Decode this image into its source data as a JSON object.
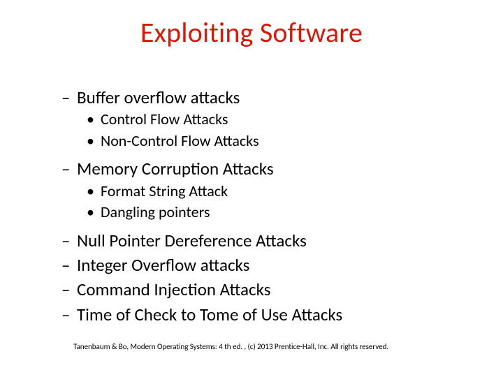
{
  "title": "Exploiting Software",
  "bullets": {
    "b1": "Buffer overflow attacks",
    "b1a": "Control Flow Attacks",
    "b1b": " Non-Control Flow Attacks",
    "b2": "Memory Corruption Attacks",
    "b2a": "Format String Attack",
    "b2b": "Dangling pointers",
    "b3": "Null Pointer Dereference Attacks",
    "b4": "Integer Overflow attacks",
    "b5": "Command Injection Attacks",
    "b6": "Time of Check to Tome of Use Attacks"
  },
  "footer": "Tanenbaum & Bo, Modern  Operating Systems: 4 th ed. , (c) 2013 Prentice-Hall, Inc. All rights reserved."
}
